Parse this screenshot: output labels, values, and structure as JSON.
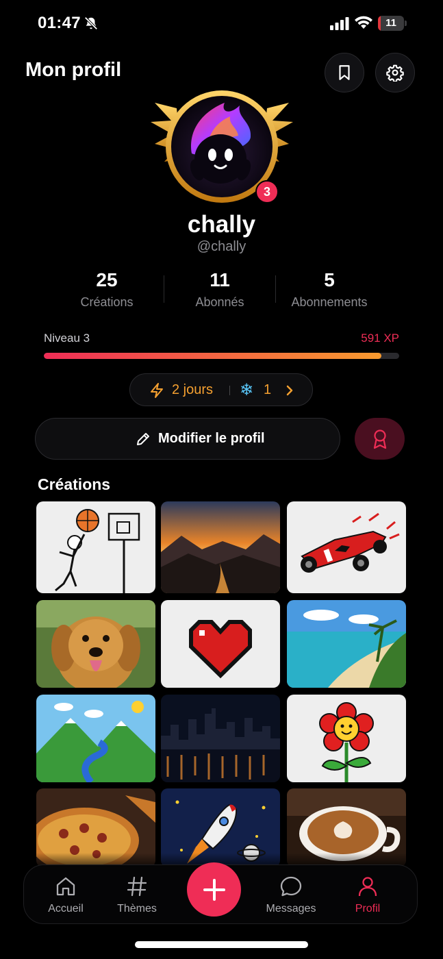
{
  "status_bar": {
    "time": "01:47",
    "battery": "11",
    "battery_level": 0.11,
    "battery_color": "#e0353b"
  },
  "header": {
    "title": "Mon profil",
    "bookmark_icon": "bookmark-icon",
    "settings_icon": "gear-icon"
  },
  "profile": {
    "notification_count": "3",
    "name": "chally",
    "handle": "@chally",
    "avatar_icon": "flame-mascot-avatar"
  },
  "stats": [
    {
      "value": "25",
      "label": "Créations"
    },
    {
      "value": "11",
      "label": "Abonnés"
    },
    {
      "value": "5",
      "label": "Abonnements"
    }
  ],
  "level": {
    "label": "Niveau 3",
    "xp": "591 XP",
    "progress": 0.95
  },
  "streak": {
    "days": "2 jours",
    "freezes": "1"
  },
  "edit_profile": {
    "label": "Modifier le profil"
  },
  "creations": {
    "title": "Créations",
    "items": [
      "basketball-stick-figure-drawing",
      "mountain-sunset-photo",
      "red-race-car-drawing",
      "golden-retriever-photo",
      "pixel-heart-drawing",
      "tropical-beach-photo",
      "mountain-river-drawing",
      "city-skyline-night-photo",
      "smiling-flower-drawing",
      "pizza-photo",
      "rocket-space-drawing",
      "latte-art-coffee-photo"
    ]
  },
  "tabbar": {
    "tabs": [
      {
        "label": "Accueil",
        "icon": "home-icon"
      },
      {
        "label": "Thèmes",
        "icon": "hashtag-icon"
      },
      {
        "label": "Messages",
        "icon": "chat-bubble-icon"
      },
      {
        "label": "Profil",
        "icon": "user-icon"
      }
    ],
    "create_icon": "plus-icon",
    "accent": "#ef2d56"
  }
}
